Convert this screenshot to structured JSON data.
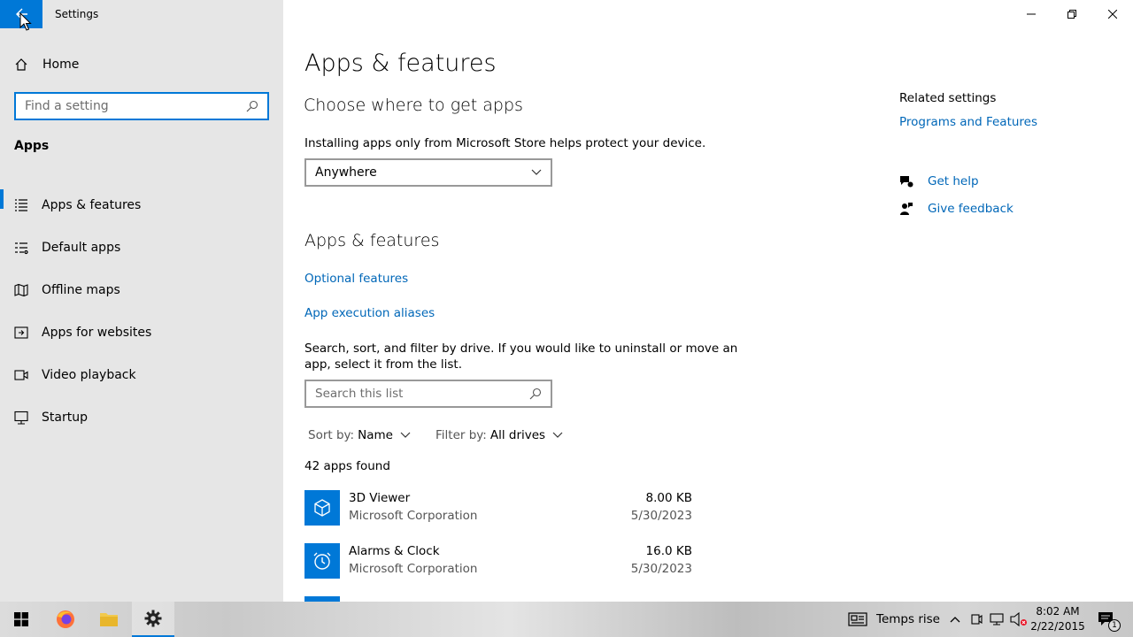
{
  "window": {
    "title": "Settings"
  },
  "sidebar": {
    "home_label": "Home",
    "search_placeholder": "Find a setting",
    "section_title": "Apps",
    "items": [
      {
        "label": "Apps & features",
        "icon": "apps-features-icon",
        "active": true
      },
      {
        "label": "Default apps",
        "icon": "default-apps-icon"
      },
      {
        "label": "Offline maps",
        "icon": "offline-maps-icon"
      },
      {
        "label": "Apps for websites",
        "icon": "apps-websites-icon"
      },
      {
        "label": "Video playback",
        "icon": "video-playback-icon"
      },
      {
        "label": "Startup",
        "icon": "startup-icon"
      }
    ]
  },
  "main": {
    "page_title": "Apps & features",
    "choose_heading": "Choose where to get apps",
    "choose_desc": "Installing apps only from Microsoft Store helps protect your device.",
    "source_dropdown_value": "Anywhere",
    "features_heading": "Apps & features",
    "optional_features_link": "Optional features",
    "app_aliases_link": "App execution aliases",
    "search_desc_line1": "Search, sort, and filter by drive. If you would like to uninstall or move an",
    "search_desc_line2": "app, select it from the list.",
    "search_placeholder": "Search this list",
    "sort_label": "Sort by:",
    "sort_value": "Name",
    "filter_label": "Filter by:",
    "filter_value": "All drives",
    "apps_found": "42 apps found",
    "apps": [
      {
        "name": "3D Viewer",
        "publisher": "Microsoft Corporation",
        "size": "8.00 KB",
        "date": "5/30/2023"
      },
      {
        "name": "Alarms & Clock",
        "publisher": "Microsoft Corporation",
        "size": "16.0 KB",
        "date": "5/30/2023"
      }
    ]
  },
  "related": {
    "title": "Related settings",
    "programs_link": "Programs and Features",
    "get_help": "Get help",
    "give_feedback": "Give feedback"
  },
  "taskbar": {
    "weather_text": "Temps rise",
    "time": "8:02 AM",
    "date": "2/22/2015",
    "notification_count": "1"
  },
  "colors": {
    "accent": "#0078d7",
    "link": "#0067b8",
    "sidebar_bg": "#e6e6e6"
  }
}
